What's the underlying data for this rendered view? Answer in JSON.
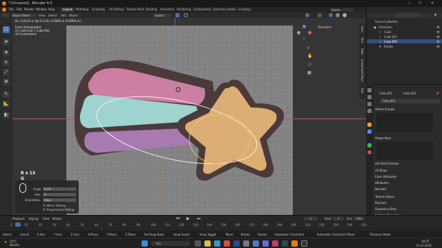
{
  "window": {
    "title": "* [Unsaved] - Blender 4.0"
  },
  "menu": [
    "File",
    "Edit",
    "Render",
    "Window",
    "Help"
  ],
  "workspaces": [
    "Layout",
    "Modeling",
    "Sculpting",
    "UV Editing",
    "Texture Paint",
    "Shading",
    "Animation",
    "Rendering",
    "Compositing",
    "Geometry Nodes",
    "Scripting"
  ],
  "active_workspace": "Layout",
  "header": {
    "mode": "Object Mode",
    "items": [
      "View",
      "Select",
      "Add",
      "Object"
    ],
    "orientation": "Global",
    "scene": "Scene",
    "view_layer": "ViewLayer",
    "transform": "Transform"
  },
  "viewport": {
    "info": [
      "Front Orthographic",
      "(1) Collection | Cube.001",
      "10 Centimeters"
    ],
    "stats": "Dx -0.0131 m  Dy 0 m  Dz -0.0994 m (0.0999 m)"
  },
  "operator": {
    "repeat_lines": [
      "R x 13",
      "G"
    ],
    "angle_label": "Angle",
    "angle_value": "0.13°",
    "axis_label": "Axis",
    "axis_value": "Z",
    "orientation_label": "Orientation",
    "orientation_value": "View",
    "mirror": "Mirror Editing",
    "proportional": "Proportional Editing"
  },
  "outliner": {
    "header": "Scene Collection",
    "items": [
      {
        "label": "Collection",
        "indent": 0
      },
      {
        "label": "Cube",
        "indent": 1
      },
      {
        "label": "Cube.001",
        "indent": 1
      },
      {
        "label": "Cube.002",
        "indent": 1,
        "selected": true
      },
      {
        "label": "Empty",
        "indent": 1
      }
    ]
  },
  "properties": {
    "breadcrumb": [
      "Cube.001",
      "Cube.002"
    ],
    "mesh_name": "Cube.002",
    "sections": [
      "Vertex Groups",
      "Shape Keys",
      "Add Rest Position",
      "UV Maps",
      "Color Attributes",
      "Attributes",
      "Normals",
      "Texture Space",
      "Remesh",
      "Geometry Data",
      "Custom Properties"
    ]
  },
  "timeline": {
    "menu": [
      "Playback",
      "Keying",
      "View",
      "Marker"
    ],
    "start_label": "Start",
    "start": "1",
    "end_label": "End",
    "end": "250",
    "current": "1",
    "ticks": [
      "0",
      "10",
      "20",
      "30",
      "40",
      "50",
      "60",
      "70",
      "80",
      "90",
      "100",
      "110",
      "120",
      "130",
      "140",
      "150",
      "160",
      "170",
      "180",
      "190",
      "200",
      "210",
      "220",
      "230",
      "240",
      "250"
    ]
  },
  "statusbar": [
    "Select",
    "Cancel",
    "X Axis",
    "Y Axis",
    "Z Axis",
    "X Plane",
    "Y Plane",
    "Z Plane",
    "Set Snap Base",
    "Snap Invert",
    "Snap Toggle",
    "Move",
    "Rotate",
    "Resize",
    "Automatic Constraint",
    "Automatic Constraint Plane",
    "Precision Mode"
  ],
  "taskbar": {
    "search": "Ara",
    "time": "18:37",
    "date": "13.12.2023",
    "weather_temp": "10°C",
    "weather_text": "Bulutlu"
  },
  "colors": {
    "accent": "#4772b3",
    "pink": "#cc7fa2",
    "teal": "#9fd3cf",
    "purple": "#a77bb2",
    "star": "#dcae73",
    "outline": "#4a3a3a",
    "selection": "#f5c070"
  },
  "sidebar_tabs": [
    "Item",
    "Tool",
    "View",
    "Screencast Keys",
    "Edit"
  ]
}
